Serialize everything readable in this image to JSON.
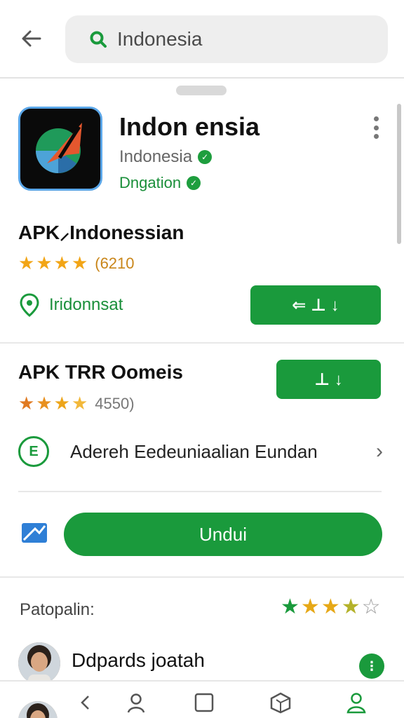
{
  "search": {
    "query": "Indonesia"
  },
  "app": {
    "title": "Indon ensia",
    "developer": "Indonesia",
    "category": "Dngation"
  },
  "section1": {
    "title": "APK⸝Indonessian",
    "stars": 4,
    "rating_count": "(6210",
    "location": "Iridonnsat",
    "action_label": "⇐ ⊥  ↓"
  },
  "section2": {
    "title": "APK TRR Oomeis",
    "stars": 4,
    "rating_count": "4550)",
    "action_label": "⊥ ↓",
    "link_text": "Adereh Eedeuniaalian Eundan"
  },
  "download": {
    "label": "Undui"
  },
  "reviews": {
    "label": "Patopalin:",
    "stars_filled": 4,
    "reviewer_name": "Ddpards joatah"
  },
  "colors": {
    "accent": "#1a9a3c",
    "star": "#f2a516"
  },
  "icons": [
    "back-arrow-icon",
    "search-icon",
    "more-vert-icon",
    "location-pin-icon",
    "mail-icon",
    "chevron-right-icon",
    "nav-back-icon",
    "person-icon",
    "square-icon",
    "box-icon",
    "profile-icon"
  ]
}
